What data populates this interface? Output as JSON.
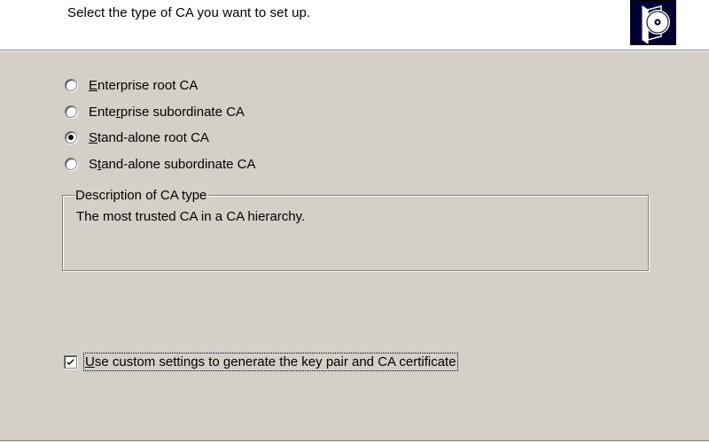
{
  "header": {
    "subtitle": "Select the type of CA you want to set up."
  },
  "ca_types": {
    "options": [
      {
        "label_pre": "",
        "label_key": "E",
        "label_post": "nterprise root CA",
        "checked": false
      },
      {
        "label_pre": "Ente",
        "label_key": "r",
        "label_post": "prise subordinate CA",
        "checked": false
      },
      {
        "label_pre": "",
        "label_key": "S",
        "label_post": "tand-alone root CA",
        "checked": true
      },
      {
        "label_pre": "S",
        "label_key": "t",
        "label_post": "and-alone subordinate CA",
        "checked": false
      }
    ]
  },
  "description": {
    "title": "Description of CA type",
    "text": "The most trusted CA in a CA hierarchy."
  },
  "custom_settings": {
    "label_pre": "",
    "label_key": "U",
    "label_post": "se custom settings to generate the key pair and CA certificate",
    "checked": true
  },
  "colors": {
    "dialog_bg": "#d4d0c8",
    "header_bg": "#ffffff",
    "icon_bg": "#000033"
  },
  "icons": {
    "wizard": "certificate-disc-icon"
  }
}
